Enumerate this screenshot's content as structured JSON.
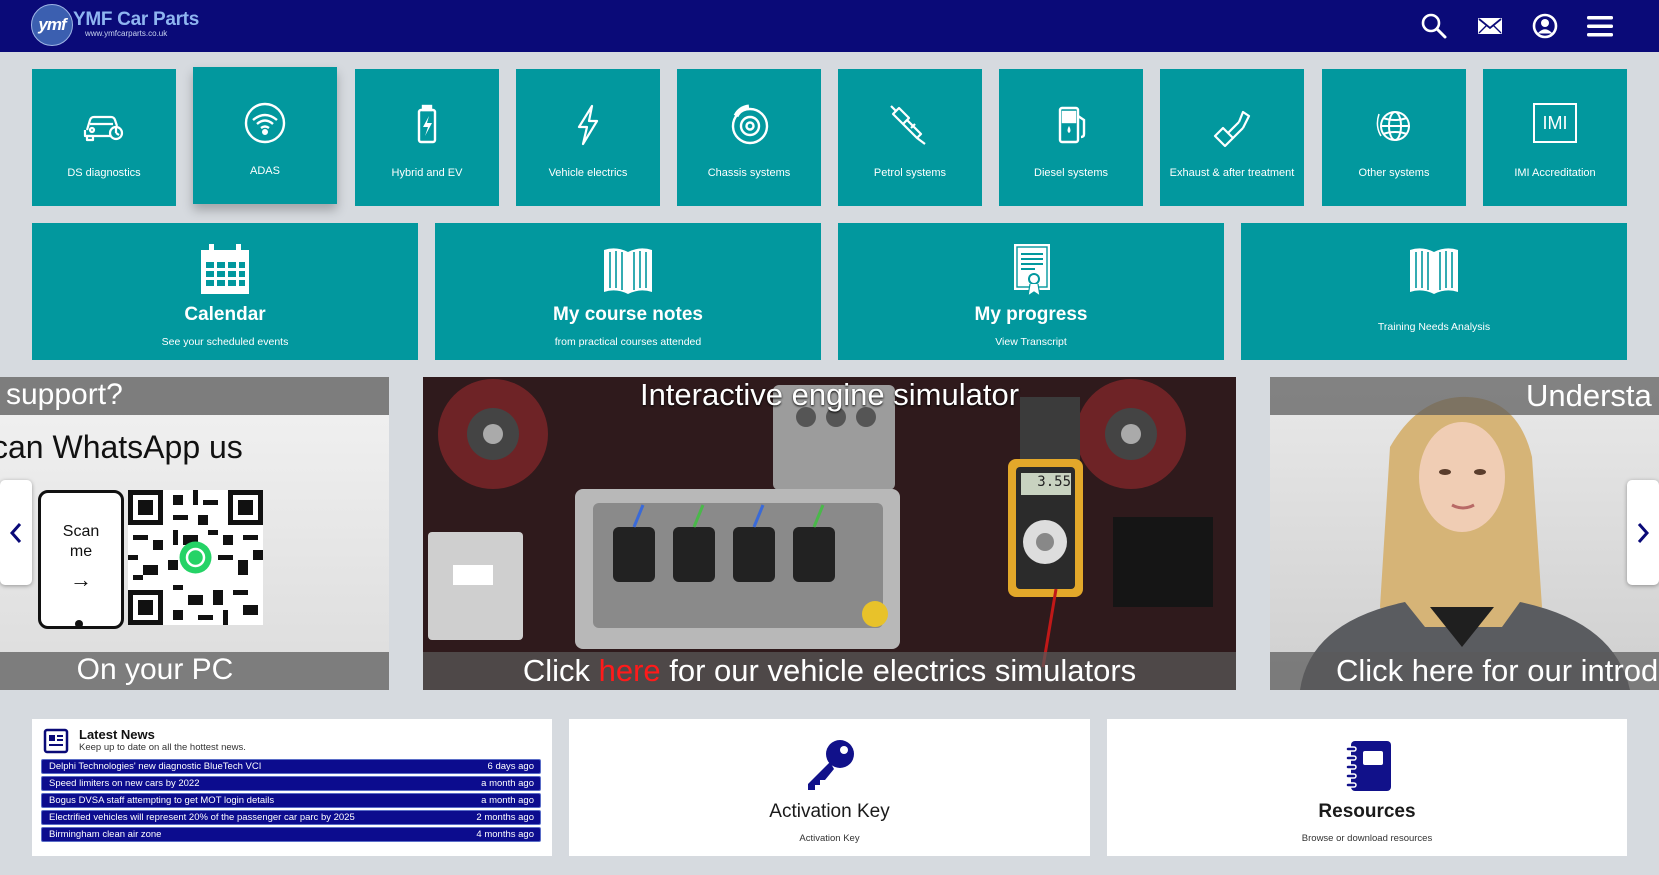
{
  "header": {
    "logo_mark": "ymf",
    "brand": "YMF Car Parts",
    "url": "www.ymfcarparts.co.uk",
    "icons": [
      "search-icon",
      "mail-icon",
      "account-icon",
      "menu-icon"
    ]
  },
  "colors": {
    "header": "#0a0a78",
    "tile": "#02989e",
    "news_row": "#0c0c8e",
    "accent_text": "#1a1a5e",
    "highlight_red": "#ff1a1a"
  },
  "modules": [
    {
      "label": "DS diagnostics",
      "icon": "car-diagnostics-icon"
    },
    {
      "label": "ADAS",
      "icon": "wifi-signal-icon"
    },
    {
      "label": "Hybrid and EV",
      "icon": "battery-icon"
    },
    {
      "label": "Vehicle electrics",
      "icon": "lightning-icon"
    },
    {
      "label": "Chassis systems",
      "icon": "brake-disc-icon"
    },
    {
      "label": "Petrol systems",
      "icon": "injector-icon"
    },
    {
      "label": "Diesel systems",
      "icon": "fuel-pump-icon"
    },
    {
      "label": "Exhaust & after treatment",
      "icon": "exhaust-pipe-icon"
    },
    {
      "label": "Other systems",
      "icon": "globe-icon"
    },
    {
      "label": "IMI Accreditation",
      "icon": "imi-logo-icon",
      "badge": "IMI"
    }
  ],
  "features": [
    {
      "title": "Calendar",
      "subtitle": "See your scheduled events",
      "icon": "calendar-icon"
    },
    {
      "title": "My course notes",
      "subtitle": "from practical courses attended",
      "icon": "open-book-icon"
    },
    {
      "title": "My progress",
      "subtitle": "View Transcript",
      "icon": "certificate-icon"
    },
    {
      "title": "",
      "subtitle": "Training Needs Analysis",
      "icon": "open-book-icon"
    }
  ],
  "carousel": {
    "left": {
      "top": "support?",
      "headline": "can WhatsApp us",
      "scan1": "Scan",
      "scan2": "me",
      "scan_arrow": "→",
      "bottom": "On your PC"
    },
    "center": {
      "title": "Interactive engine simulator",
      "caption_pre": "Click ",
      "caption_link": "here",
      "caption_post": " for our vehicle electrics simulators",
      "meter": "3.55"
    },
    "right": {
      "title": "Understa",
      "bottom": "Click here for our introdu"
    },
    "prev_icon": "chevron-left-icon",
    "next_icon": "chevron-right-icon"
  },
  "news": {
    "title": "Latest News",
    "subtitle": "Keep up to date on all the hottest news.",
    "items": [
      {
        "title": "Delphi Technologies' new diagnostic BlueTech VCI",
        "age": "6 days ago"
      },
      {
        "title": "Speed limiters on new cars by 2022",
        "age": "a month ago"
      },
      {
        "title": "Bogus DVSA staff attempting to get MOT login details",
        "age": "a month ago"
      },
      {
        "title": "Electrified vehicles will represent 20% of the passenger car parc by 2025",
        "age": "2 months ago"
      },
      {
        "title": "Birmingham clean air zone",
        "age": "4 months ago"
      }
    ]
  },
  "activation": {
    "title": "Activation Key",
    "subtitle": "Activation Key"
  },
  "resources": {
    "title": "Resources",
    "subtitle": "Browse or download resources"
  }
}
